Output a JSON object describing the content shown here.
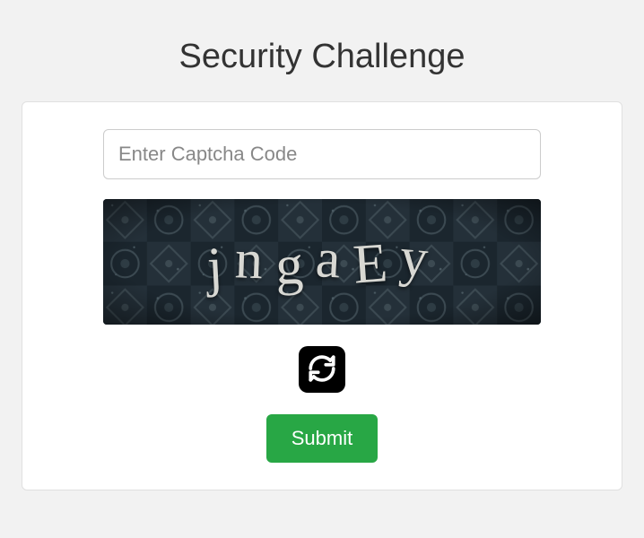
{
  "title": "Security Challenge",
  "input": {
    "placeholder": "Enter Captcha Code",
    "value": ""
  },
  "captcha": {
    "code": "jngaEy"
  },
  "buttons": {
    "submit": "Submit"
  },
  "colors": {
    "accent": "#28a745"
  }
}
